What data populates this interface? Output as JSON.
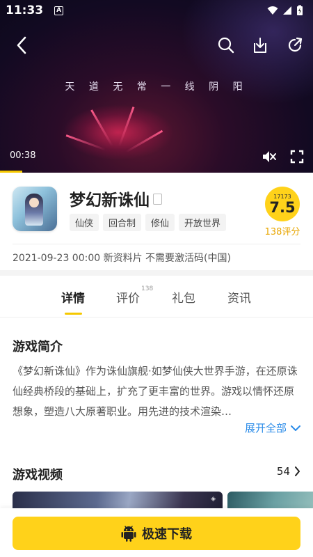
{
  "status_bar": {
    "time": "11:33",
    "notification_icon": "A"
  },
  "video": {
    "caption": "天 道 无 常   一 线 阴 阳",
    "elapsed": "00:38",
    "progress": 0.07,
    "icons": [
      "back-icon",
      "search-icon",
      "download-icon",
      "share-icon",
      "mute-icon",
      "fullscreen-icon"
    ]
  },
  "game": {
    "title": "梦幻新诛仙",
    "tags": [
      "仙侠",
      "回合制",
      "修仙",
      "开放世界"
    ],
    "score_source": "17173",
    "score": "7.5",
    "rating_count": "138评分",
    "release_info": "2021-09-23 00:00 新资料片 不需要激活码(中国)"
  },
  "tabs": [
    {
      "label": "详情",
      "active": true,
      "badge": ""
    },
    {
      "label": "评价",
      "active": false,
      "badge": "138"
    },
    {
      "label": "礼包",
      "active": false,
      "badge": ""
    },
    {
      "label": "资讯",
      "active": false,
      "badge": ""
    }
  ],
  "intro": {
    "title": "游戏简介",
    "text": "《梦幻新诛仙》作为诛仙旗舰·如梦仙侠大世界手游，在还原诛仙经典桥段的基础上，扩充了更丰富的世界。游戏以情怀还原想象，塑造八大原著职业。用先进的技术渲染…",
    "expand_label": "展开全部"
  },
  "videos_section": {
    "title": "游戏视频",
    "count": "54"
  },
  "bottom": {
    "download_label": "极速下载"
  },
  "colors": {
    "accent": "#ffd21a",
    "link": "#2a8be8",
    "rating": "#e8a600"
  }
}
